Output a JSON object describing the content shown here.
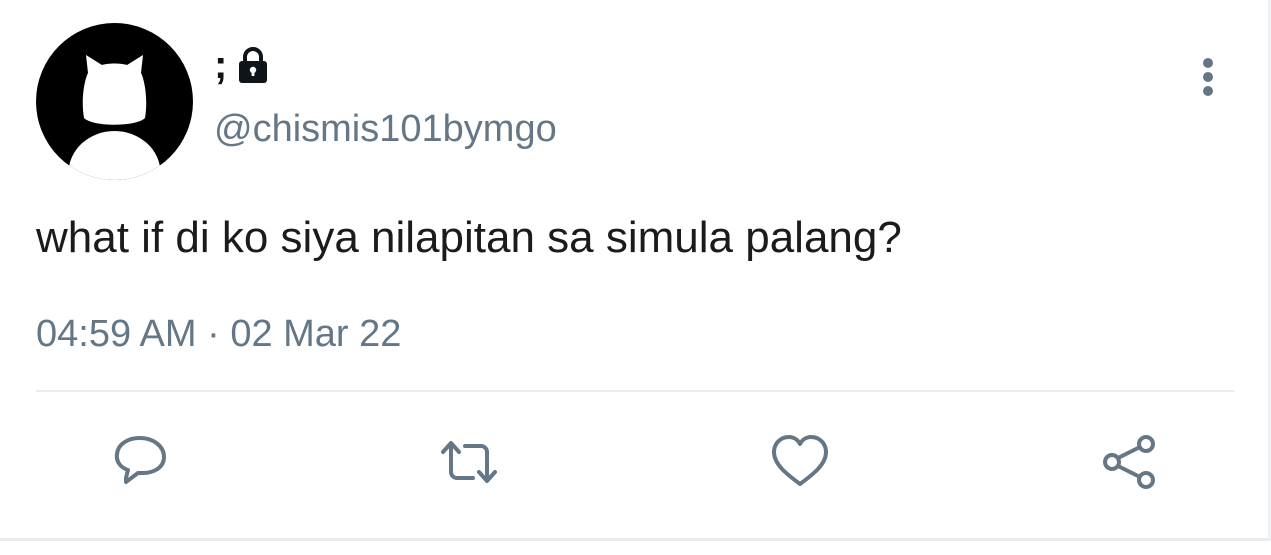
{
  "tweet": {
    "display_name": ";",
    "handle": "@chismis101bymgo",
    "text": "what if di ko siya nilapitan sa simula palang?",
    "timestamp": "04:59 AM · 02 Mar 22",
    "protected": true
  },
  "icons": {
    "avatar": "cat-silhouette-avatar",
    "lock": "lock-icon",
    "more": "more-vertical-icon",
    "reply": "reply-icon",
    "retweet": "retweet-icon",
    "like": "heart-icon",
    "share": "share-icon"
  },
  "colors": {
    "text": "#1b1b1b",
    "secondary": "#657786",
    "divider": "#e6ecf0",
    "icon": "#657786"
  }
}
